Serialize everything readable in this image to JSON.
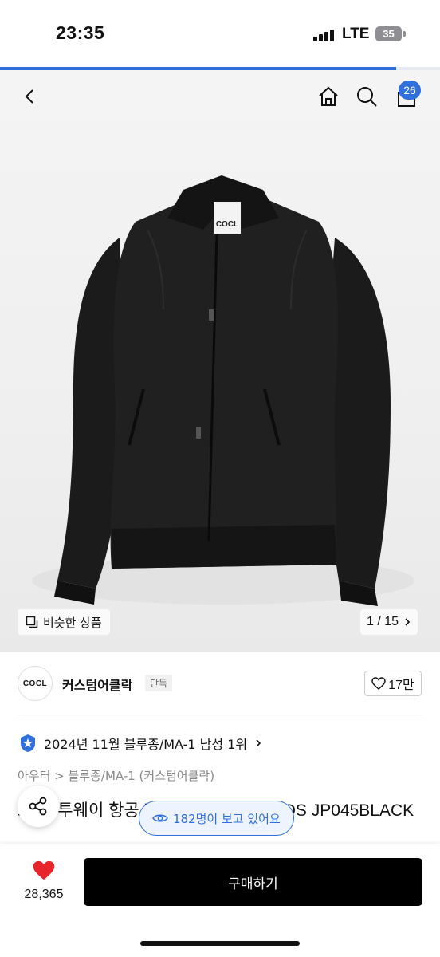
{
  "status": {
    "time": "23:35",
    "network": "LTE",
    "battery": "35"
  },
  "scroll_progress_fraction": 0.9,
  "nav": {
    "back_icon": "chevron-left-icon",
    "home_icon": "home-icon",
    "search_icon": "search-icon",
    "cart_icon": "cart-icon",
    "cart_count": "26"
  },
  "gallery": {
    "similar_label": "비슷한 상품",
    "page_indicator": "1 / 15",
    "jacket_logo_text": "COCL"
  },
  "brand": {
    "logo_text": "COCL",
    "name": "커스텀어클락",
    "tag": "단독",
    "likes": "17만"
  },
  "product": {
    "ranking": "2024년 11월 블루종/MA-1 남성 1위",
    "category": "아우터 > 블루종/MA-1 (커스텀어클락)",
    "name": "프 트 투웨이 항공 재킷 [2COLOR COOS JP045BLACK",
    "viewers": "182명이 보고 있어요"
  },
  "bottom": {
    "wishlist_count": "28,365",
    "buy_label": "구매하기"
  },
  "colors": {
    "accent": "#2f6fde",
    "heart": "#e8242c",
    "button": "#000000"
  }
}
